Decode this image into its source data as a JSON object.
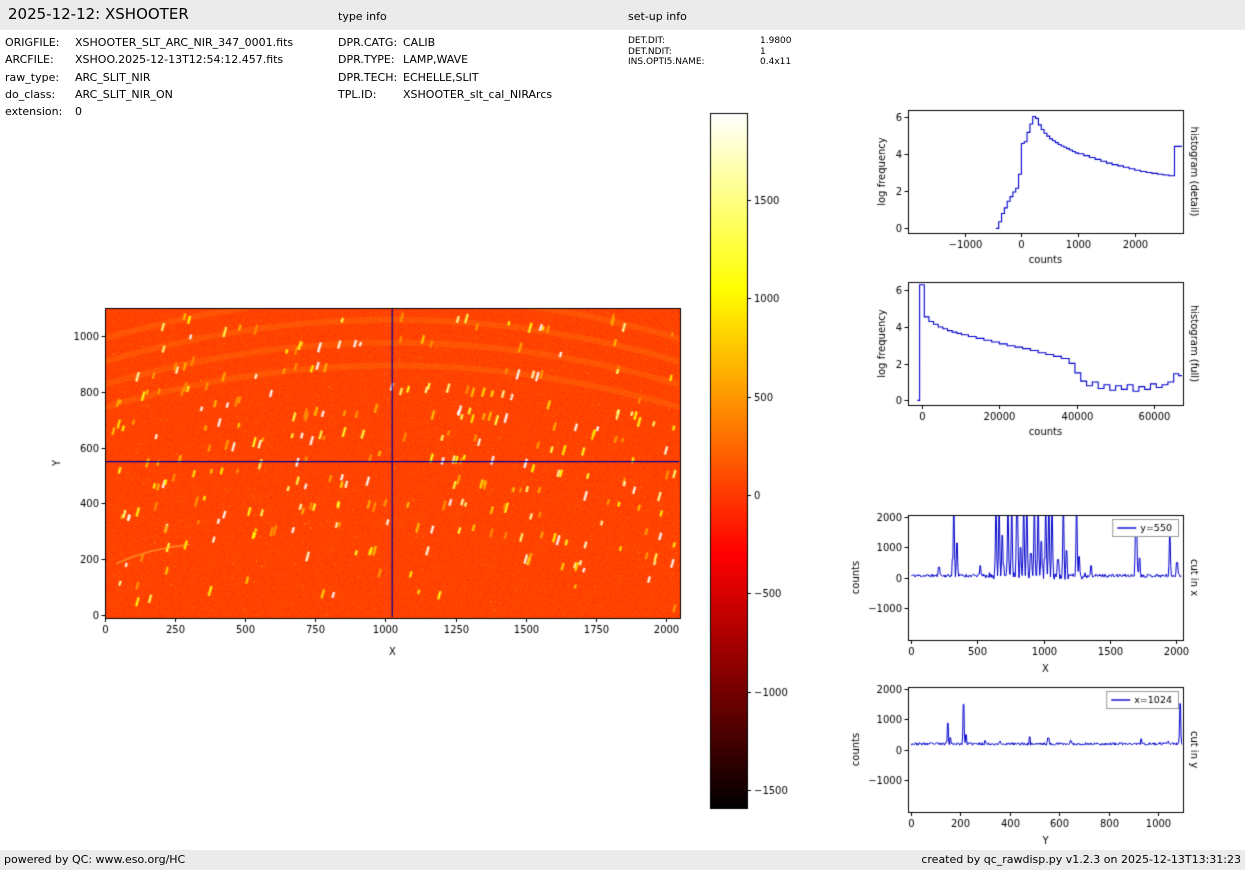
{
  "header": {
    "title": "2025-12-12: XSHOOTER",
    "type_info_label": "type info",
    "setup_info_label": "set-up info"
  },
  "metadata": {
    "left": [
      {
        "key": "ORIGFILE:",
        "value": "XSHOOTER_SLT_ARC_NIR_347_0001.fits"
      },
      {
        "key": "ARCFILE:",
        "value": "XSHOO.2025-12-13T12:54:12.457.fits"
      },
      {
        "key": "raw_type:",
        "value": "ARC_SLIT_NIR"
      },
      {
        "key": "do_class:",
        "value": "ARC_SLIT_NIR_ON"
      },
      {
        "key": "extension:",
        "value": "0"
      }
    ],
    "middle": [
      {
        "key": "DPR.CATG:",
        "value": "CALIB"
      },
      {
        "key": "DPR.TYPE:",
        "value": "LAMP,WAVE"
      },
      {
        "key": "DPR.TECH:",
        "value": "ECHELLE,SLIT"
      },
      {
        "key": "TPL.ID:",
        "value": "XSHOOTER_slt_cal_NIRArcs"
      }
    ],
    "right": [
      {
        "key": "DET.DIT:",
        "value": "1.9800"
      },
      {
        "key": "DET.NDIT:",
        "value": "1"
      },
      {
        "key": "INS.OPTI5.NAME:",
        "value": "0.4x11"
      }
    ]
  },
  "footer": {
    "left": "powered by QC: www.eso.org/HC",
    "right": "created by qc_rawdisp.py v1.2.3 on 2025-12-13T13:31:23"
  },
  "chart_data": [
    {
      "id": "main_image",
      "type": "heatmap",
      "title": "",
      "xlabel": "X",
      "ylabel": "Y",
      "xlim": [
        0,
        2050
      ],
      "ylim": [
        -10,
        1100
      ],
      "xticks": [
        0,
        250,
        500,
        750,
        1000,
        1250,
        1500,
        1750,
        2000
      ],
      "yticks": [
        0,
        200,
        400,
        600,
        800,
        1000
      ],
      "colormap": "hot",
      "cmap_range": [
        -1590,
        1940
      ],
      "colorbar_ticks": [
        1500,
        1000,
        500,
        0,
        -500,
        -1000,
        -1500
      ],
      "crosshair": {
        "x": 1024,
        "y": 550,
        "color": "#000099"
      },
      "description": "XSHOOTER NIR raw arc-lamp echelle frame: bright tilted emission-line segments along curved spectral orders on an orange (~0 count) background; blue crosshair marks x=1024, y=550"
    },
    {
      "id": "histogram_detail",
      "type": "line",
      "style": "step",
      "color": "#0000cc",
      "xlabel": "counts",
      "ylabel": "log frequency",
      "right_label": "histogram (detail)",
      "xlim": [
        -2000,
        2850
      ],
      "ylim": [
        -0.25,
        6.35
      ],
      "xticks": [
        -1000,
        0,
        1000,
        2000
      ],
      "yticks": [
        0,
        2,
        4,
        6
      ],
      "steps": [
        [
          -450,
          0
        ],
        [
          -400,
          0.35
        ],
        [
          -350,
          0.8
        ],
        [
          -300,
          1.1
        ],
        [
          -250,
          1.45
        ],
        [
          -200,
          1.7
        ],
        [
          -150,
          1.95
        ],
        [
          -100,
          2.15
        ],
        [
          -50,
          2.9
        ],
        [
          0,
          4.55
        ],
        [
          50,
          4.65
        ],
        [
          100,
          5.15
        ],
        [
          150,
          5.6
        ],
        [
          200,
          6.0
        ],
        [
          250,
          5.9
        ],
        [
          300,
          5.55
        ],
        [
          350,
          5.3
        ],
        [
          400,
          5.1
        ],
        [
          450,
          4.95
        ],
        [
          500,
          4.8
        ],
        [
          550,
          4.7
        ],
        [
          600,
          4.6
        ],
        [
          650,
          4.5
        ],
        [
          700,
          4.42
        ],
        [
          750,
          4.35
        ],
        [
          800,
          4.28
        ],
        [
          850,
          4.2
        ],
        [
          900,
          4.12
        ],
        [
          950,
          4.05
        ],
        [
          1000,
          4.0
        ],
        [
          1100,
          3.9
        ],
        [
          1200,
          3.8
        ],
        [
          1300,
          3.7
        ],
        [
          1400,
          3.6
        ],
        [
          1500,
          3.5
        ],
        [
          1600,
          3.42
        ],
        [
          1700,
          3.35
        ],
        [
          1800,
          3.28
        ],
        [
          1900,
          3.2
        ],
        [
          2000,
          3.12
        ],
        [
          2100,
          3.05
        ],
        [
          2200,
          3.0
        ],
        [
          2300,
          2.95
        ],
        [
          2400,
          2.9
        ],
        [
          2500,
          2.86
        ],
        [
          2600,
          2.82
        ],
        [
          2700,
          4.4
        ]
      ]
    },
    {
      "id": "histogram_full",
      "type": "line",
      "style": "step",
      "color": "#0000cc",
      "xlabel": "counts",
      "ylabel": "log frequency",
      "right_label": "histogram (full)",
      "xlim": [
        -3600,
        67400
      ],
      "ylim": [
        -0.25,
        6.45
      ],
      "xticks": [
        0,
        20000,
        40000,
        60000
      ],
      "yticks": [
        0,
        2,
        4,
        6
      ],
      "steps": [
        [
          -1200,
          0
        ],
        [
          -600,
          6.3
        ],
        [
          600,
          4.55
        ],
        [
          1800,
          4.3
        ],
        [
          3000,
          4.15
        ],
        [
          4200,
          4.0
        ],
        [
          5400,
          3.9
        ],
        [
          6600,
          3.8
        ],
        [
          7800,
          3.72
        ],
        [
          9000,
          3.65
        ],
        [
          10200,
          3.58
        ],
        [
          12000,
          3.48
        ],
        [
          14000,
          3.38
        ],
        [
          16000,
          3.28
        ],
        [
          18000,
          3.18
        ],
        [
          20000,
          3.08
        ],
        [
          22000,
          2.98
        ],
        [
          24000,
          2.9
        ],
        [
          26000,
          2.82
        ],
        [
          28000,
          2.72
        ],
        [
          30000,
          2.6
        ],
        [
          32000,
          2.5
        ],
        [
          34000,
          2.4
        ],
        [
          36000,
          2.28
        ],
        [
          38000,
          2.02
        ],
        [
          39500,
          1.5
        ],
        [
          41000,
          1.05
        ],
        [
          42500,
          0.8
        ],
        [
          44000,
          1.0
        ],
        [
          45500,
          0.65
        ],
        [
          47000,
          0.85
        ],
        [
          48500,
          0.55
        ],
        [
          50000,
          0.8
        ],
        [
          51500,
          0.6
        ],
        [
          53000,
          0.85
        ],
        [
          54500,
          0.5
        ],
        [
          56000,
          0.75
        ],
        [
          57500,
          0.6
        ],
        [
          59000,
          0.9
        ],
        [
          60500,
          0.7
        ],
        [
          62000,
          0.85
        ],
        [
          63500,
          1.0
        ],
        [
          65000,
          1.45
        ],
        [
          66300,
          1.35
        ]
      ]
    },
    {
      "id": "cut_x",
      "type": "line",
      "color": "#0000cc",
      "legend": "y=550",
      "xlabel": "X",
      "ylabel": "counts",
      "right_label": "cut in x",
      "xlim": [
        -25,
        2055
      ],
      "ylim": [
        -2050,
        2070
      ],
      "xticks": [
        0,
        500,
        1000,
        1500,
        2000
      ],
      "yticks": [
        -1000,
        0,
        1000,
        2000
      ],
      "xrange": [
        0,
        2048
      ],
      "baseline": 70,
      "noise": 55,
      "noisy_region": [
        560,
        1330
      ],
      "peaks": [
        [
          210,
          350
        ],
        [
          320,
          2060
        ],
        [
          345,
          1150
        ],
        [
          520,
          400
        ],
        [
          640,
          2060
        ],
        [
          665,
          2060
        ],
        [
          690,
          1400
        ],
        [
          730,
          2060
        ],
        [
          760,
          2060
        ],
        [
          800,
          2060
        ],
        [
          825,
          1000
        ],
        [
          850,
          2060
        ],
        [
          875,
          2060
        ],
        [
          905,
          800
        ],
        [
          930,
          2060
        ],
        [
          960,
          2060
        ],
        [
          985,
          1200
        ],
        [
          1015,
          2060
        ],
        [
          1040,
          2060
        ],
        [
          1065,
          2060
        ],
        [
          1110,
          600
        ],
        [
          1150,
          2060
        ],
        [
          1175,
          900
        ],
        [
          1250,
          2060
        ],
        [
          1270,
          700
        ],
        [
          1360,
          400
        ],
        [
          1700,
          1850
        ],
        [
          1725,
          650
        ],
        [
          1955,
          1350
        ],
        [
          2010,
          500
        ]
      ]
    },
    {
      "id": "cut_y",
      "type": "line",
      "color": "#0000cc",
      "legend": "x=1024",
      "xlabel": "Y",
      "ylabel": "counts",
      "right_label": "cut in y",
      "xlim": [
        -12,
        1100
      ],
      "ylim": [
        -2050,
        2070
      ],
      "xticks": [
        0,
        200,
        400,
        600,
        800,
        1000
      ],
      "yticks": [
        -1000,
        0,
        1000,
        2000
      ],
      "xrange": [
        0,
        1095
      ],
      "baseline": 195,
      "noise": 45,
      "peaks": [
        [
          148,
          880
        ],
        [
          160,
          400
        ],
        [
          212,
          1500
        ],
        [
          222,
          500
        ],
        [
          300,
          300
        ],
        [
          360,
          280
        ],
        [
          480,
          430
        ],
        [
          555,
          390
        ],
        [
          645,
          310
        ],
        [
          930,
          360
        ],
        [
          1040,
          280
        ],
        [
          1088,
          1520
        ]
      ]
    }
  ]
}
